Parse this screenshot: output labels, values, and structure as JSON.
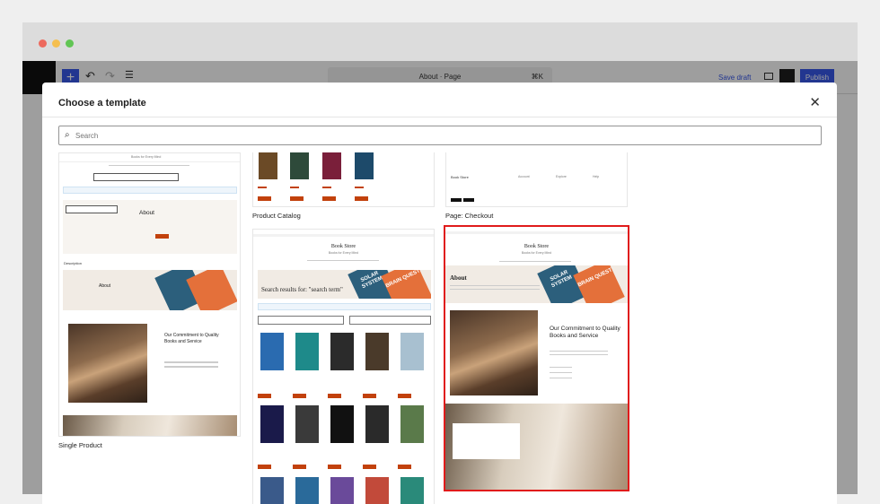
{
  "window": {
    "traffic_colors": [
      "#ed6a5e",
      "#f5bf4f",
      "#61c554"
    ]
  },
  "editor": {
    "toolbar": {
      "add_label": "+",
      "undo_icon": "↶",
      "redo_icon": "↷",
      "list_view_icon": "☰",
      "command_title": "About · Page",
      "shortcut": "⌘K",
      "save_draft": "Save draft",
      "publish": "Publish"
    }
  },
  "modal": {
    "title": "Choose a template",
    "close_icon": "✕",
    "search": {
      "placeholder": "Search",
      "value": ""
    },
    "templates": [
      {
        "name": "Single Product",
        "selected": false,
        "preview": {
          "tagline": "Books for Every Mind",
          "heading": "About",
          "section": "Description",
          "subheading": "Our Commitment to Quality Books and Service"
        }
      },
      {
        "name": "Product Catalog",
        "selected": false
      },
      {
        "name": "Page: Checkout",
        "selected": false,
        "preview": {
          "brand": "Book Store",
          "columns": [
            "Account",
            "Explore",
            "Help"
          ]
        }
      },
      {
        "name": "",
        "selected": false,
        "preview": {
          "brand": "Book Store",
          "tagline": "Books for Every Mind",
          "heading": "Search results for: \"search term\"",
          "covers": [
            "SOLAR SYSTEM",
            "BRAIN QUEST"
          ]
        }
      },
      {
        "name": "",
        "selected": true,
        "preview": {
          "brand": "Book Store",
          "tagline": "Books for Every Mind",
          "heading": "About",
          "subheading": "Our Commitment to Quality Books and Service",
          "covers": [
            "SOLAR SYSTEM",
            "BRAIN QUEST"
          ]
        }
      }
    ]
  }
}
